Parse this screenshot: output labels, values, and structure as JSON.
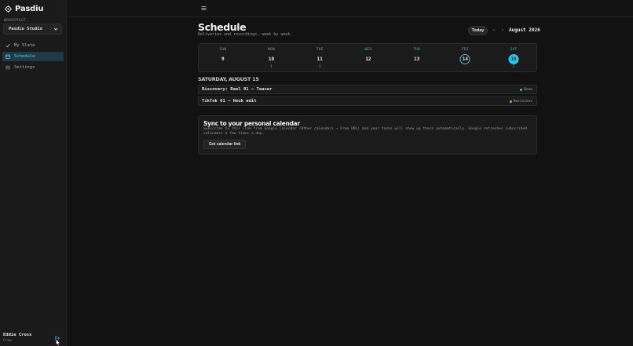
{
  "app": {
    "name": "Pasdiu"
  },
  "sidebar": {
    "workspace_label": "WORKSPACE",
    "workspace_value": "Pasdiu Studio",
    "items": [
      {
        "label": "My Slate",
        "icon": "check-icon",
        "active": false
      },
      {
        "label": "Schedule",
        "icon": "calendar-icon",
        "active": true
      },
      {
        "label": "Settings",
        "icon": "sliders-icon",
        "active": false
      }
    ],
    "user": {
      "name": "Eddie Cross",
      "role": "Crew"
    }
  },
  "page": {
    "title": "Schedule",
    "subtitle": "Deliveries and recordings, week by week.",
    "today_label": "Today",
    "prev_arrow": "‹",
    "next_arrow": "›",
    "month_label": "August 2026"
  },
  "week": {
    "days": [
      {
        "name": "SUN",
        "num": "9",
        "count": "",
        "state": "normal"
      },
      {
        "name": "MON",
        "num": "10",
        "count": "1",
        "state": "normal"
      },
      {
        "name": "TUE",
        "num": "11",
        "count": "1",
        "state": "normal"
      },
      {
        "name": "WED",
        "num": "12",
        "count": "",
        "state": "normal"
      },
      {
        "name": "THU",
        "num": "13",
        "count": "",
        "state": "normal"
      },
      {
        "name": "FRI",
        "num": "14",
        "count": "",
        "state": "ring"
      },
      {
        "name": "SAT",
        "num": "15",
        "count": "2",
        "state": "filled"
      }
    ]
  },
  "selected_date": "SATURDAY, AUGUST 15",
  "tasks": [
    {
      "title": "Discovery: Reel 01 — Teaser",
      "status": "Done",
      "status_color": "#3cc9a0"
    },
    {
      "title": "TikTok 01 — Hook edit",
      "status": "Revisions",
      "status_color": "#e0a030"
    }
  ],
  "sync": {
    "title": "Sync to your personal calendar",
    "description": "Subscribe to this link from Google Calendar (Other calendars → From URL) and your tasks will show up there automatically. Google refreshes subscribed calendars a few times a day.",
    "button_label": "Get calendar link"
  },
  "colors": {
    "accent": "#2bc3ea",
    "background": "#121212",
    "panel": "#1b1b1b"
  }
}
